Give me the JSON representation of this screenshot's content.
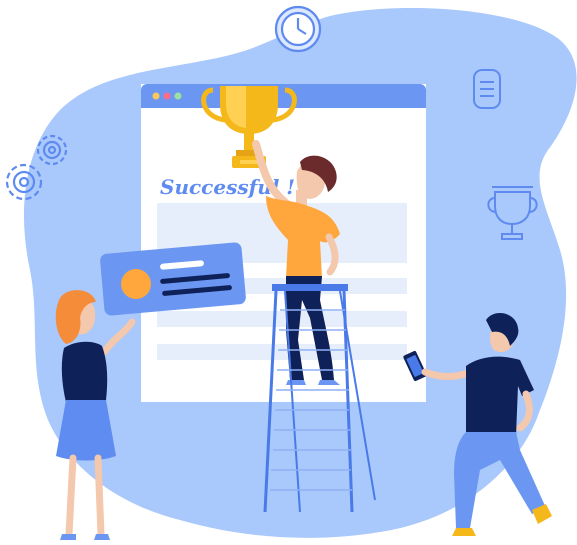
{
  "headline": "Successful !",
  "colors": {
    "blob": "#a9c8fb",
    "line_icon": "#5f8bf0",
    "window_frame": "#6b97f2",
    "window_body": "#ffffff",
    "placeholder_bar": "#e6eefc",
    "trophy_gold": "#f5b81a",
    "shirt_orange": "#ffa63d",
    "navy": "#0f2159",
    "hair_woman": "#f58c3a",
    "dress_blue": "#5e8cf0",
    "ladder": "#4a7ae8"
  },
  "icons": [
    "clock-icon",
    "list-icon",
    "gear-icon",
    "trophy-outline-icon",
    "profile-card-icon",
    "trophy-icon"
  ],
  "window_controls": [
    "minimize-dot",
    "maximize-dot",
    "close-dot"
  ]
}
